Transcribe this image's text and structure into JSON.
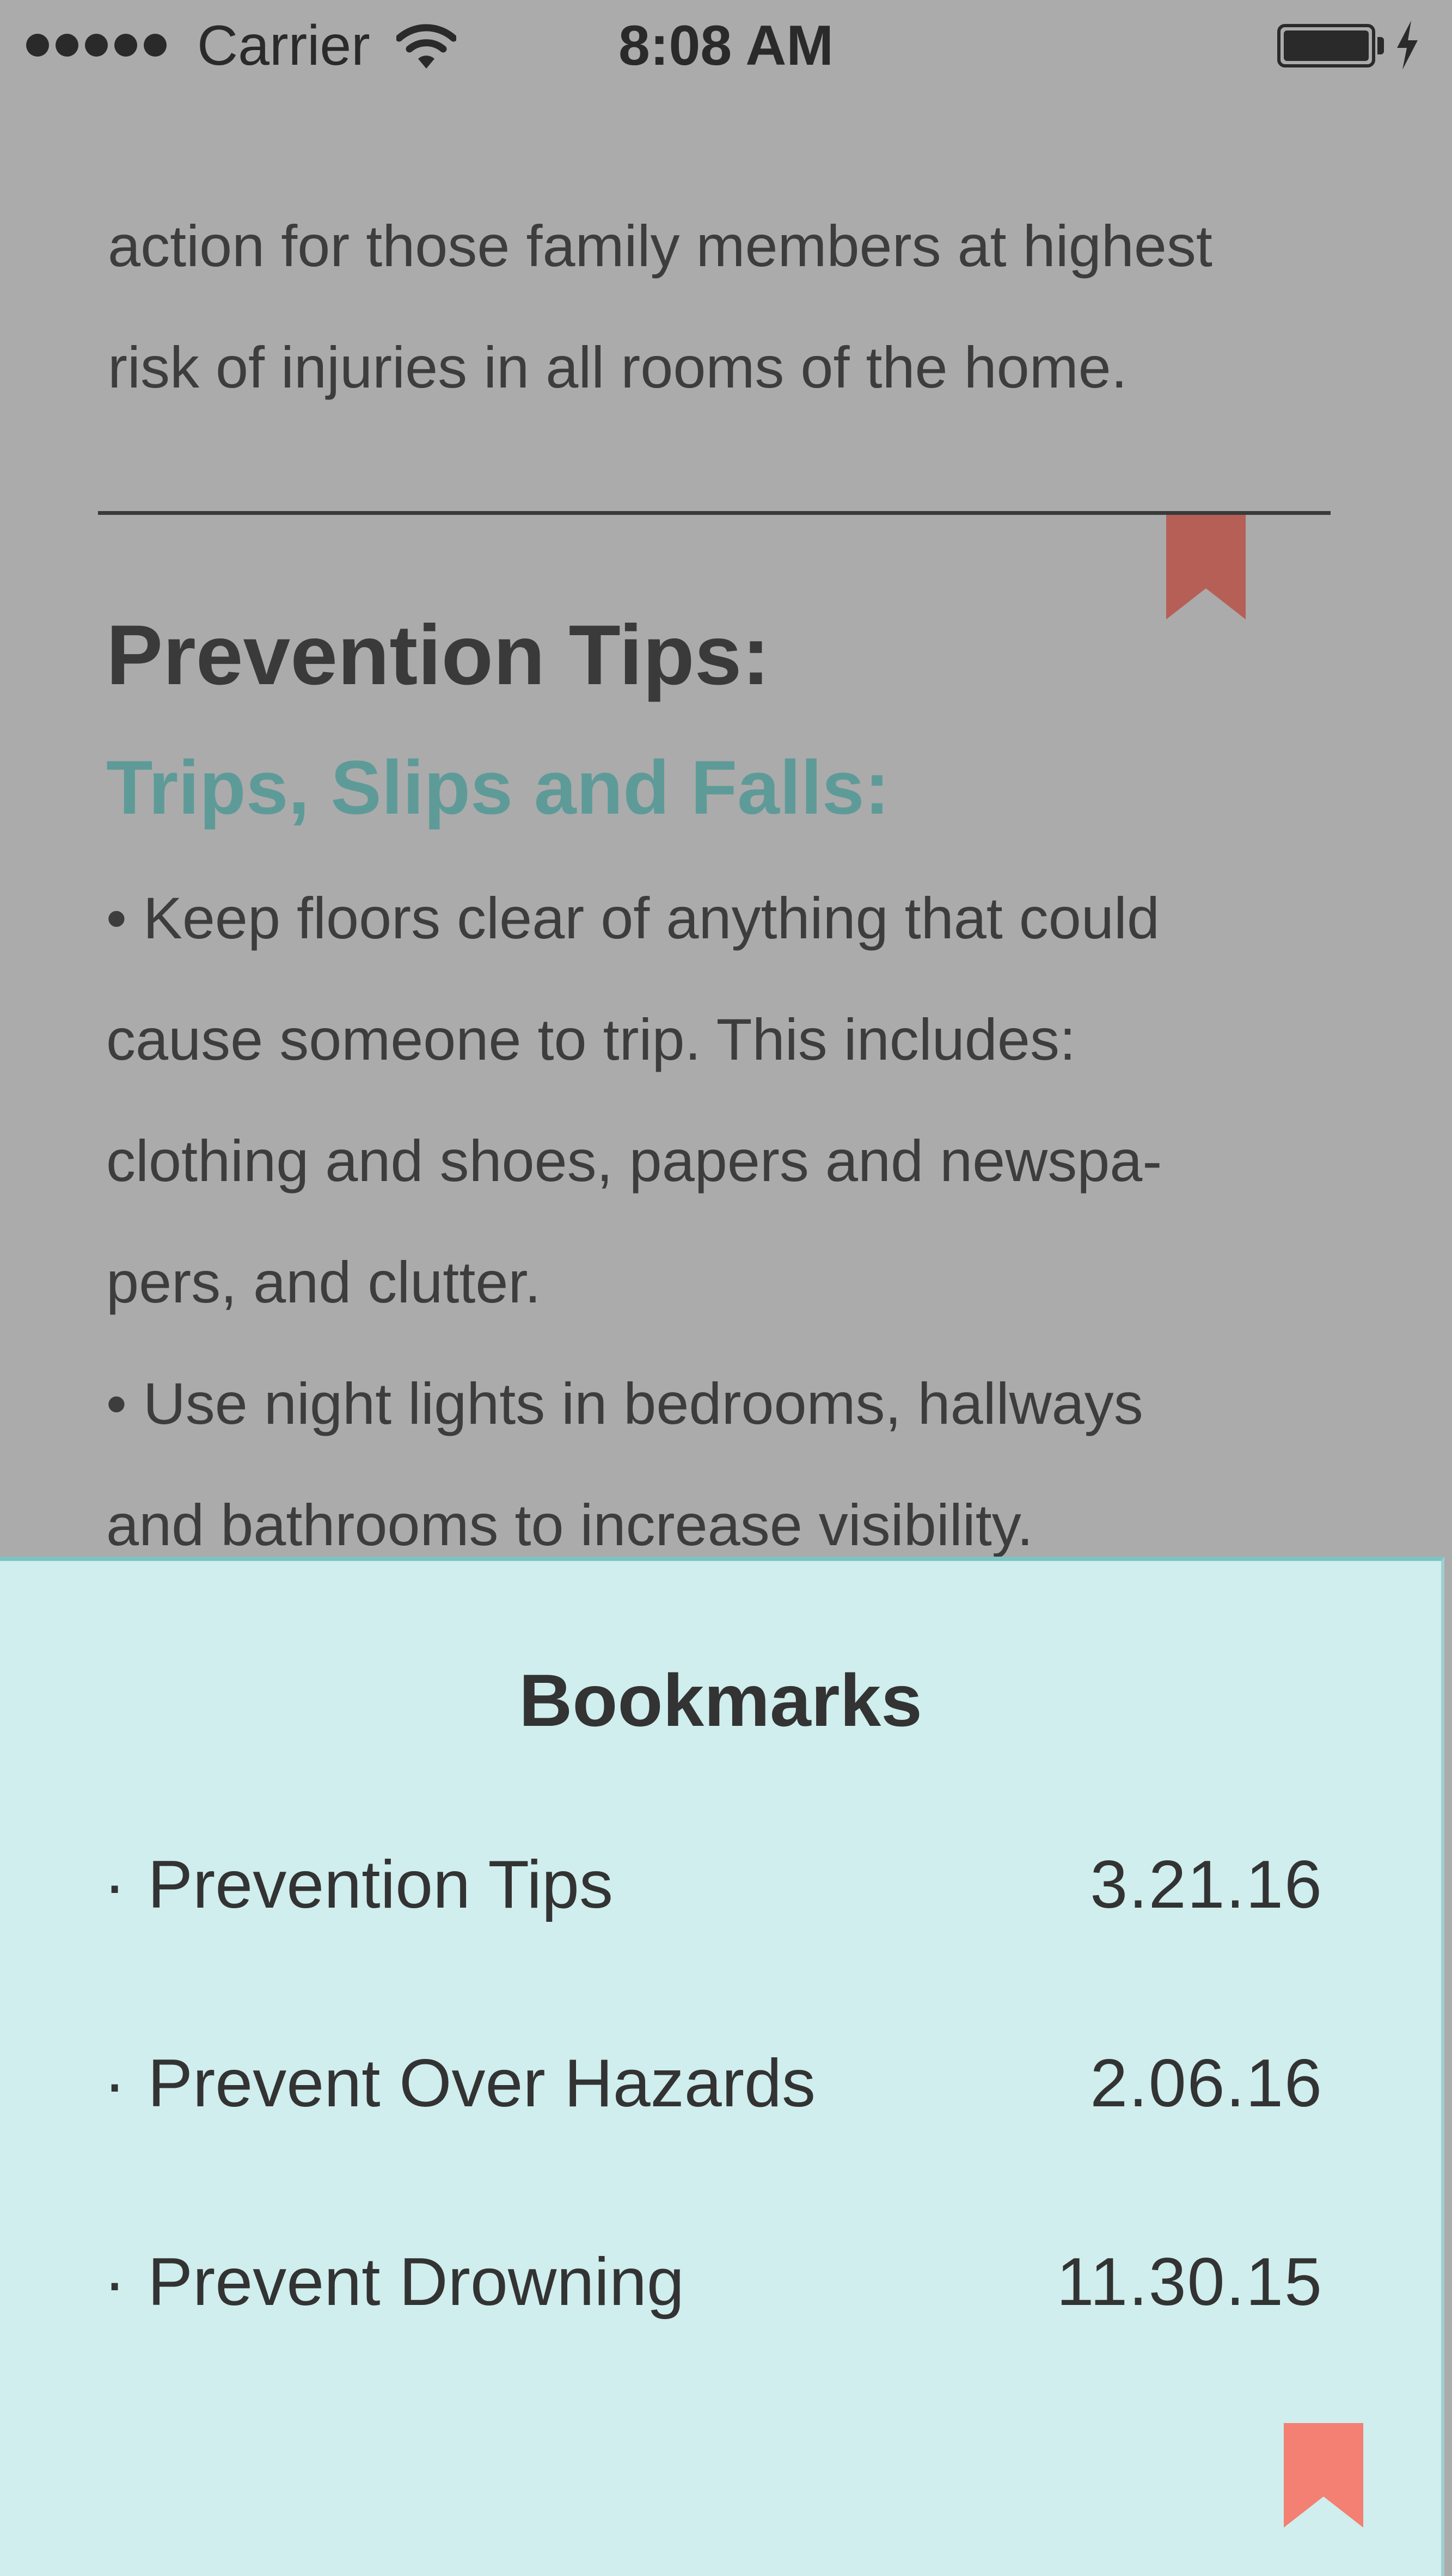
{
  "status_bar": {
    "carrier": "Carrier",
    "time": "8:08 AM"
  },
  "article": {
    "intro_lines": [
      "action for those family members at highest",
      "risk of injuries in all rooms of the home."
    ],
    "section_title": "Prevention Tips:",
    "subsection_title": "Trips, Slips and Falls:",
    "tip_lines": [
      "• Keep floors clear of anything that could",
      "cause someone to trip. This includes:",
      "clothing and shoes, papers and newspa-",
      "pers, and clutter.",
      "• Use night lights in bedrooms, hallways",
      "and bathrooms to increase visibility."
    ]
  },
  "bookmarks": {
    "title": "Bookmarks",
    "bullet": "·",
    "items": [
      {
        "label": "Prevention Tips",
        "date": "3.21.16"
      },
      {
        "label": "Prevent Over Hazards",
        "date": "2.06.16"
      },
      {
        "label": "Prevent Drowning",
        "date": "11.30.15"
      }
    ]
  },
  "colors": {
    "overlay_background": "#ababab",
    "subsection_accent": "#5e9b98",
    "panel_background": "#cfeeed",
    "bookmark_ribbon_dimmed": "#b65f57",
    "bookmark_ribbon": "#f47f73"
  },
  "icons": {
    "signal": "signal-dots-icon",
    "wifi": "wifi-icon",
    "battery": "battery-icon",
    "charging": "charging-bolt-icon",
    "article_bookmark": "bookmark-ribbon-icon",
    "panel_bookmark": "bookmark-ribbon-icon"
  }
}
